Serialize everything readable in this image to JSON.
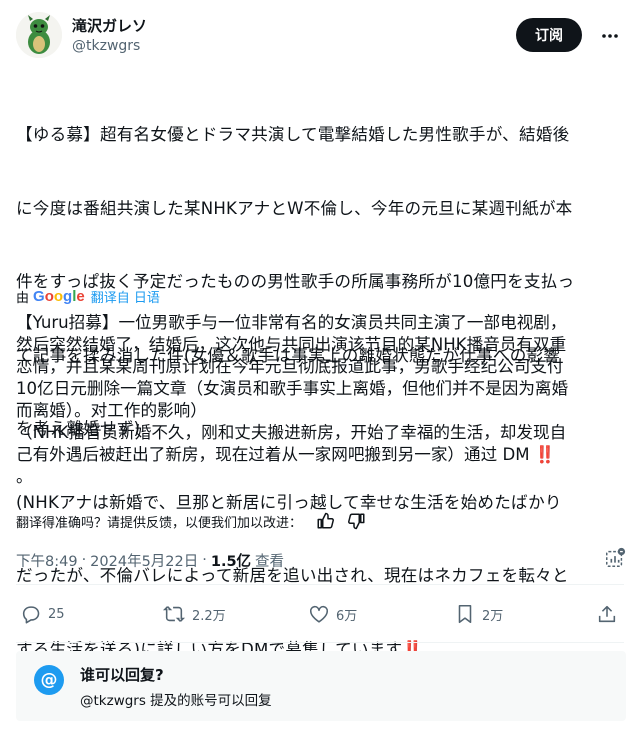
{
  "author": {
    "display_name": "滝沢ガレソ",
    "handle": "@tkzwgrs"
  },
  "header": {
    "subscribe_label": "订阅",
    "more_icon": "more-horizontal-icon"
  },
  "tweet": {
    "original_lines": [
      "【ゆる募】超有名女優とドラマ共演して電撃結婚した男性歌手が、結婚後",
      "に今度は番組共演した某NHKアナとW不倫し、今年の元旦に某週刊紙が本",
      "件をすっぱ抜く予定だったものの男性歌手の所属事務所が10億円を支払っ",
      "て記事を揉み消した件(女優＆歌手は事実上の離婚状態だが仕事への影響",
      "を考え離婚せず)",
      "(NHKアナは新婚で、旦那と新居に引っ越して幸せな生活を始めたばかり",
      "だったが、不倫バレによって新居を追い出され、現在はネカフェを転々と",
      "する生活を送る)に詳しい方をDMで募集しています"
    ],
    "emoji": "‼️"
  },
  "translation_bar": {
    "by": "由",
    "provider": "Google",
    "link_label": "翻译自 日语"
  },
  "translation": {
    "lines": [
      "【Yuru招募】一位男歌手与一位非常有名的女演员共同主演了一部电视剧，",
      "然后突然结婚了，结婚后，这次他与共同出演该节目的某NHK播音员有双重",
      "恋情，并且某某周刊原计划在今年元旦彻底报道此事，男歌手经纪公司支付",
      "10亿日元删除一篇文章（女演员和歌手事实上离婚，但他们并不是因为离婚",
      "而离婚）。对工作的影响）",
      "（NHK播音员新婚不久，刚和丈夫搬进新房，开始了幸福的生活，却发现自",
      "己有外遇后被赶出了新房，现在过着从一家网吧搬到另一家）通过 DM",
      "。"
    ]
  },
  "feedback": {
    "prompt": "翻译得准确吗？请提供反馈，以便我们加以改进："
  },
  "meta": {
    "time": "下午8:49",
    "separator": "·",
    "date": "2024年5月22日",
    "views": "1.5亿",
    "views_label": "查看"
  },
  "actions": {
    "replies": "25",
    "reposts": "2.2万",
    "likes": "6万",
    "bookmarks": "2万"
  },
  "reply_settings": {
    "title": "谁可以回复?",
    "subtitle": "@tkzwgrs 提及的账号可以回复"
  },
  "colors": {
    "accent": "#1d9bf0",
    "text": "#0f1419",
    "muted": "#536471",
    "emoji_red": "#dd2e44"
  }
}
